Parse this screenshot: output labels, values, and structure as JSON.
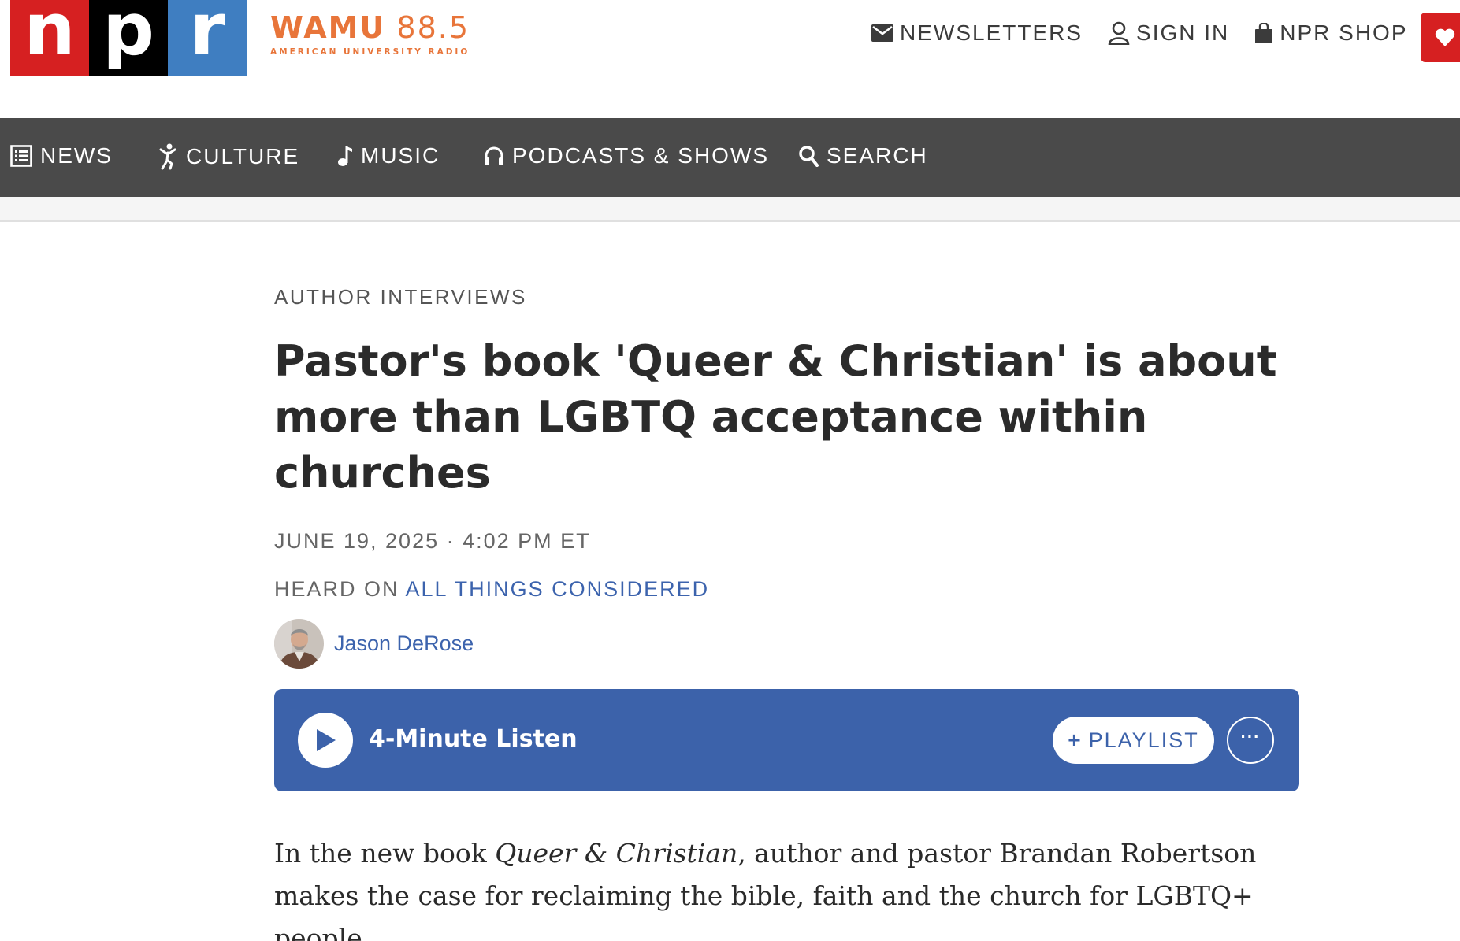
{
  "header": {
    "logo": {
      "n": "n",
      "p": "p",
      "r": "r"
    },
    "station": {
      "call_bold": "WAMU",
      "call_freq": "88.5",
      "subtitle": "AMERICAN UNIVERSITY RADIO"
    },
    "links": [
      {
        "label": "NEWSLETTERS",
        "icon": "mail-icon"
      },
      {
        "label": "SIGN IN",
        "icon": "user-icon"
      },
      {
        "label": "NPR SHOP",
        "icon": "shopping-bag-icon"
      }
    ],
    "donate_icon": "heart-icon"
  },
  "nav": {
    "items": [
      {
        "label": "NEWS",
        "icon": "news-icon"
      },
      {
        "label": "CULTURE",
        "icon": "culture-icon"
      },
      {
        "label": "MUSIC",
        "icon": "music-note-icon"
      },
      {
        "label": "PODCASTS & SHOWS",
        "icon": "headphones-icon"
      },
      {
        "label": "SEARCH",
        "icon": "search-icon"
      }
    ]
  },
  "article": {
    "kicker": "AUTHOR INTERVIEWS",
    "headline": "Pastor's book 'Queer & Christian' is about more than LGBTQ acceptance within churches",
    "dateline": "JUNE 19, 2025 · 4:02 PM ET",
    "heard_prefix": "HEARD ON ",
    "heard_show": "ALL THINGS CONSIDERED",
    "author": "Jason DeRose",
    "player": {
      "listen_label": "4-Minute Listen",
      "playlist_label": "PLAYLIST",
      "playlist_prefix": "+",
      "more_label": "···"
    },
    "teaser": {
      "part1": "In the new book ",
      "book_title": "Queer & Christian",
      "part2": ", author and pastor Brandan Robertson makes the case for reclaiming the bible, faith and the church for LGBTQ+ people."
    }
  },
  "colors": {
    "npr_red": "#d62021",
    "npr_black": "#000000",
    "npr_blue": "#3f7ec1",
    "wamu_orange": "#e8753a",
    "nav_bg": "#4a4a4a",
    "link_blue": "#3c63ad",
    "player_bg": "#3c62aa"
  }
}
